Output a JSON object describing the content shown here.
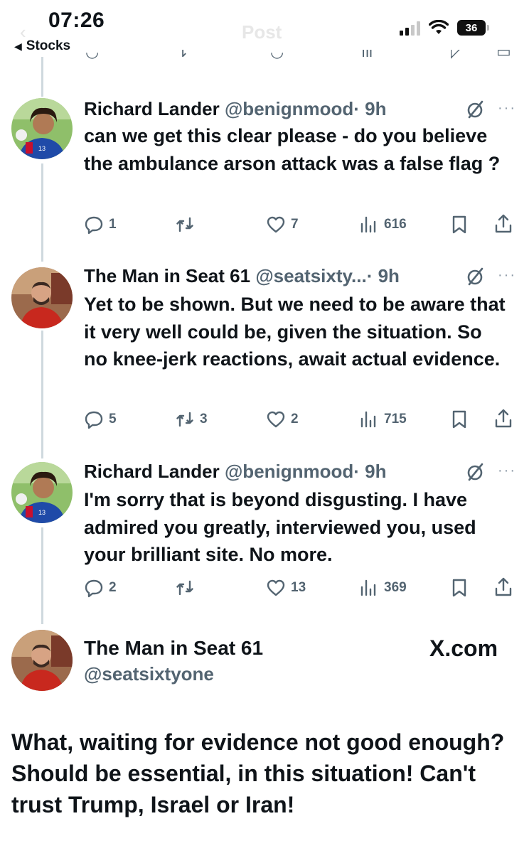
{
  "status_bar": {
    "time": "07:26",
    "back_label": "Stocks",
    "battery": "36",
    "ghost_title": "Post"
  },
  "tweets": [
    {
      "name": "Richard Lander",
      "handle": "@benignmood",
      "time": "· 9h",
      "text": "can we get this clear please - do you believe the ambulance arson attack was a false flag ?",
      "replies": "1",
      "reposts": "",
      "likes": "7",
      "views": "616"
    },
    {
      "name": "The Man in Seat 61",
      "handle": "@seatsixty...",
      "time": "· 9h",
      "text": "Yet to be shown.  But we need to be aware that it very well could be, given the situation.  So no knee-jerk reactions, await actual evidence.",
      "replies": "5",
      "reposts": "3",
      "likes": "2",
      "views": "715"
    },
    {
      "name": "Richard Lander",
      "handle": "@benignmood",
      "time": "· 9h",
      "text": "I'm sorry that is beyond disgusting. I have admired you greatly, interviewed you, used your brilliant site. No more.",
      "replies": "2",
      "reposts": "",
      "likes": "13",
      "views": "369"
    }
  ],
  "footer_author": {
    "name": "The Man in Seat 61",
    "handle": "@seatsixtyone",
    "site": "X.com"
  },
  "caption": "What, waiting for evidence not good enough? Should be essential, in this situation!  Can't trust Trump, Israel or Iran!",
  "colors": {
    "text": "#0f1419",
    "secondary": "#536471",
    "thread_line": "#cfd9de"
  }
}
